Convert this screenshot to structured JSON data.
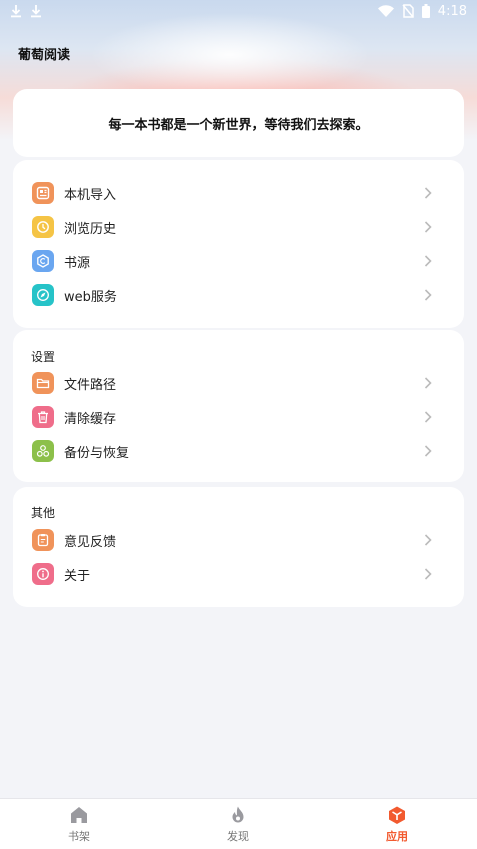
{
  "status_bar": {
    "time": "4:18"
  },
  "app": {
    "title": "葡萄阅读"
  },
  "intro": {
    "text": "每一本书都是一个新世界，等待我们去探索。"
  },
  "group1": {
    "items": [
      {
        "label": "本机导入",
        "icon": "local-import-icon",
        "color": "#f0935a"
      },
      {
        "label": "浏览历史",
        "icon": "history-icon",
        "color": "#f5c445"
      },
      {
        "label": "书源",
        "icon": "book-source-icon",
        "color": "#6aa6f0"
      },
      {
        "label": "web服务",
        "icon": "web-service-icon",
        "color": "#26c3c8"
      }
    ]
  },
  "group2": {
    "title": "设置",
    "items": [
      {
        "label": "文件路径",
        "icon": "folder-icon",
        "color": "#f0935a"
      },
      {
        "label": "清除缓存",
        "icon": "trash-icon",
        "color": "#ef6d8a"
      },
      {
        "label": "备份与恢复",
        "icon": "backup-icon",
        "color": "#8cc04a"
      }
    ]
  },
  "group3": {
    "title": "其他",
    "items": [
      {
        "label": "意见反馈",
        "icon": "feedback-icon",
        "color": "#f0935a"
      },
      {
        "label": "关于",
        "icon": "info-icon",
        "color": "#ef6d8a"
      }
    ]
  },
  "bottom_nav": {
    "items": [
      {
        "label": "书架",
        "icon": "home-icon",
        "active": false
      },
      {
        "label": "发现",
        "icon": "flame-icon",
        "active": false
      },
      {
        "label": "应用",
        "icon": "cube-icon",
        "active": true
      }
    ],
    "active_color": "#f25a2f"
  }
}
